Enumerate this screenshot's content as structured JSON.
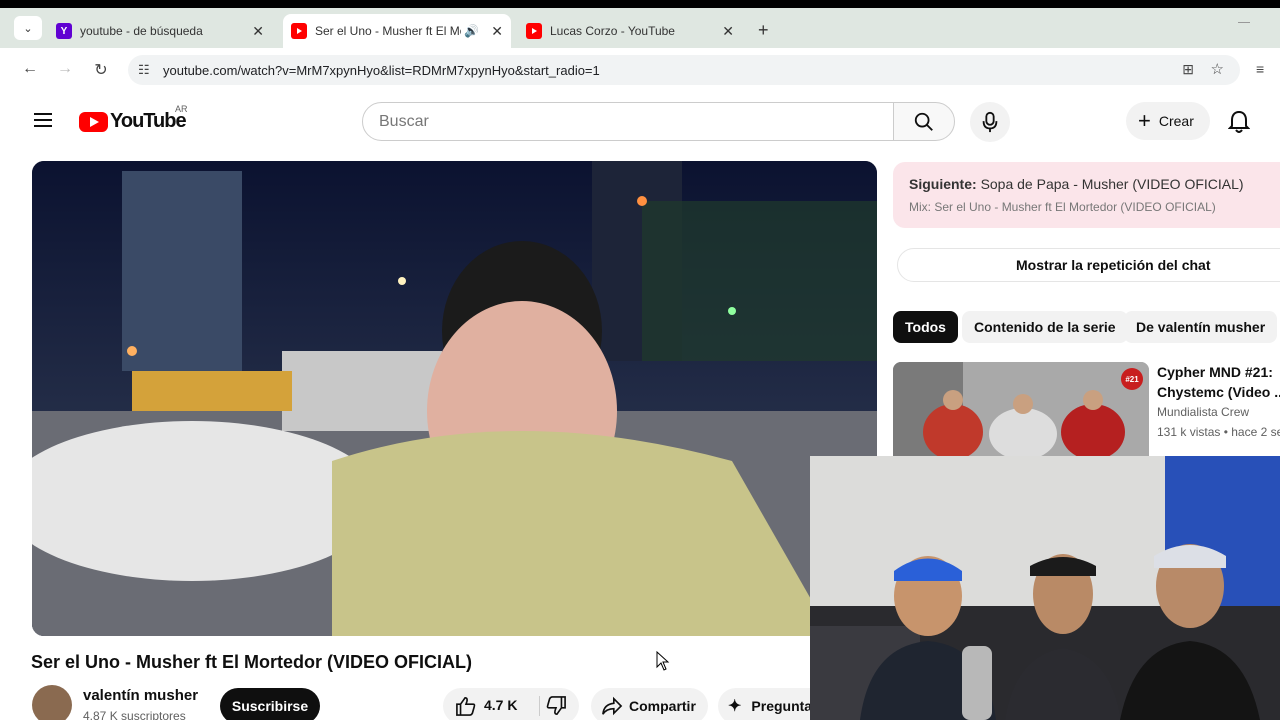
{
  "browser": {
    "tabs": [
      {
        "title": "youtube - de búsqueda",
        "icon": "yahoo-icon"
      },
      {
        "title": "Ser el Uno - Musher ft El Mortedor",
        "icon": "youtube-icon",
        "audio": true
      },
      {
        "title": "Lucas Corzo - YouTube",
        "icon": "youtube-icon"
      }
    ],
    "url": "youtube.com/watch?v=MrM7xpynHyo&list=RDMrM7xpynHyo&start_radio=1"
  },
  "youtube": {
    "logo_text": "YouTube",
    "region": "AR",
    "search_placeholder": "Buscar",
    "create_label": "Crear"
  },
  "video": {
    "title": "Ser el Uno - Musher ft El Mortedor (VIDEO OFICIAL)",
    "channel": "valentín musher",
    "subscribers": "4.87 K suscriptores",
    "subscribe_label": "Suscribirse",
    "likes": "4.7 K",
    "share_label": "Compartir",
    "ask_label": "Preguntar"
  },
  "sidebar": {
    "next_label": "Siguiente:",
    "next_title": "Sopa de Papa - Musher (VIDEO OFICIAL)",
    "mix_label": "Mix: Ser el Uno - Musher ft El Mortedor (VIDEO OFICIAL)",
    "chat_replay": "Mostrar la repetición del chat",
    "chips": [
      "Todos",
      "Contenido de la serie",
      "De valentín musher"
    ],
    "recommended": {
      "title": "Cypher MND #21: Chystemc (Video ...",
      "channel": "Mundialista Crew",
      "meta": "131 k vistas • hace 2 se",
      "badge": "#21"
    }
  },
  "colors": {
    "yt_red": "#ff0000",
    "next_bg": "#fbe5ea",
    "tabbar_bg": "#dfe7e1"
  }
}
